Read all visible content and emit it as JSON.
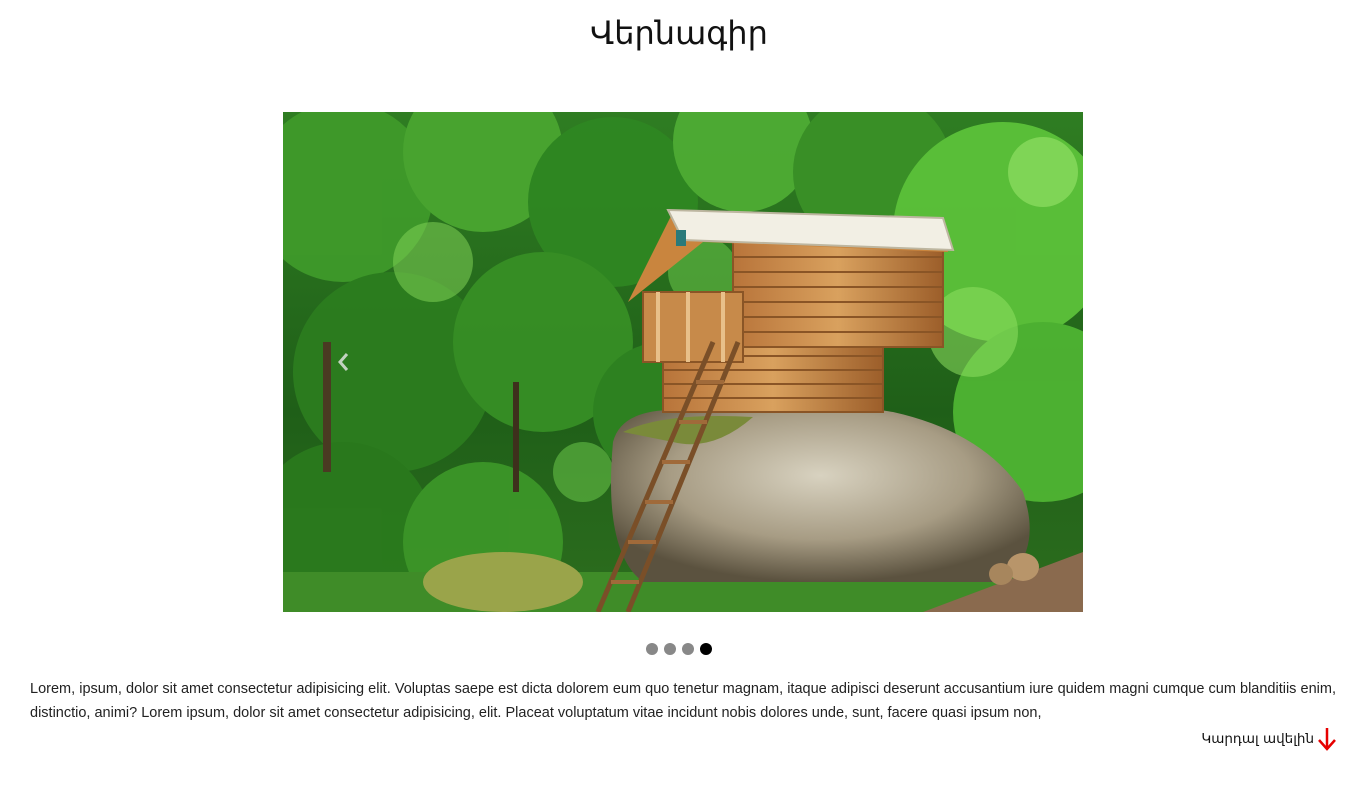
{
  "page": {
    "title": "Վերնագիր"
  },
  "carousel": {
    "slide_count": 4,
    "active_index": 3,
    "image_icon": "treehouse-forest-photo",
    "prev_icon": "chevron-left-icon"
  },
  "article": {
    "text": "Lorem, ipsum, dolor sit amet consectetur adipisicing elit. Voluptas saepe est dicta dolorem eum quo tenetur magnam, itaque adipisci deserunt accusantium iure quidem magni cumque cum blanditiis enim, distinctio, animi? Lorem ipsum, dolor sit amet consectetur adipisicing, elit. Placeat voluptatum vitae incidunt nobis dolores unde, sunt, facere quasi ipsum non,",
    "read_more_label": "Կարդալ ավելին",
    "read_more_icon": "arrow-down-icon"
  },
  "colors": {
    "read_more_arrow": "#e60000",
    "dot_inactive": "#888888",
    "dot_active": "#000000"
  }
}
